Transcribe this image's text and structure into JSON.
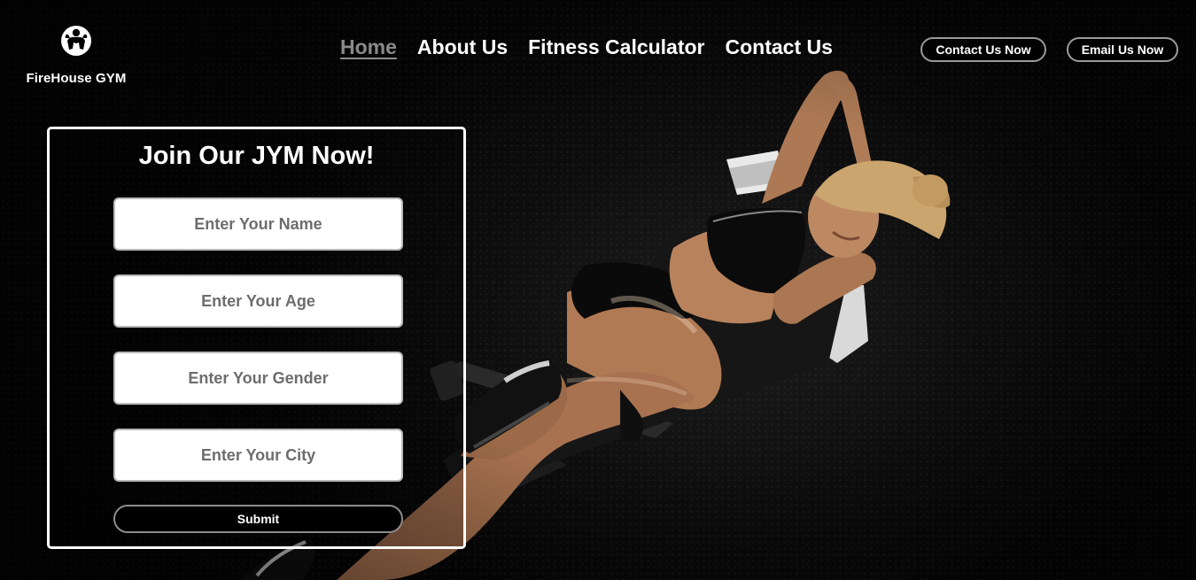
{
  "brand": {
    "name": "FireHouse GYM",
    "logo_icon": "bodybuilder-icon"
  },
  "nav": {
    "items": [
      {
        "label": "Home",
        "active": true
      },
      {
        "label": "About Us",
        "active": false
      },
      {
        "label": "Fitness Calculator",
        "active": false
      },
      {
        "label": "Contact Us",
        "active": false
      }
    ]
  },
  "header_buttons": {
    "contact_label": "Contact Us Now",
    "email_label": "Email Us Now"
  },
  "join_form": {
    "title": "Join Our JYM Now!",
    "name_placeholder": "Enter Your Name",
    "age_placeholder": "Enter Your Age",
    "gender_placeholder": "Enter Your Gender",
    "city_placeholder": "Enter Your City",
    "submit_label": "Submit"
  },
  "hero": {
    "image": "woman-doing-sit-ups-on-bench"
  },
  "colors": {
    "background": "#000000",
    "text": "#ffffff",
    "nav_active": "#8a8a8a",
    "placeholder": "#6d6d6d",
    "button_border": "#9a9a9a"
  }
}
